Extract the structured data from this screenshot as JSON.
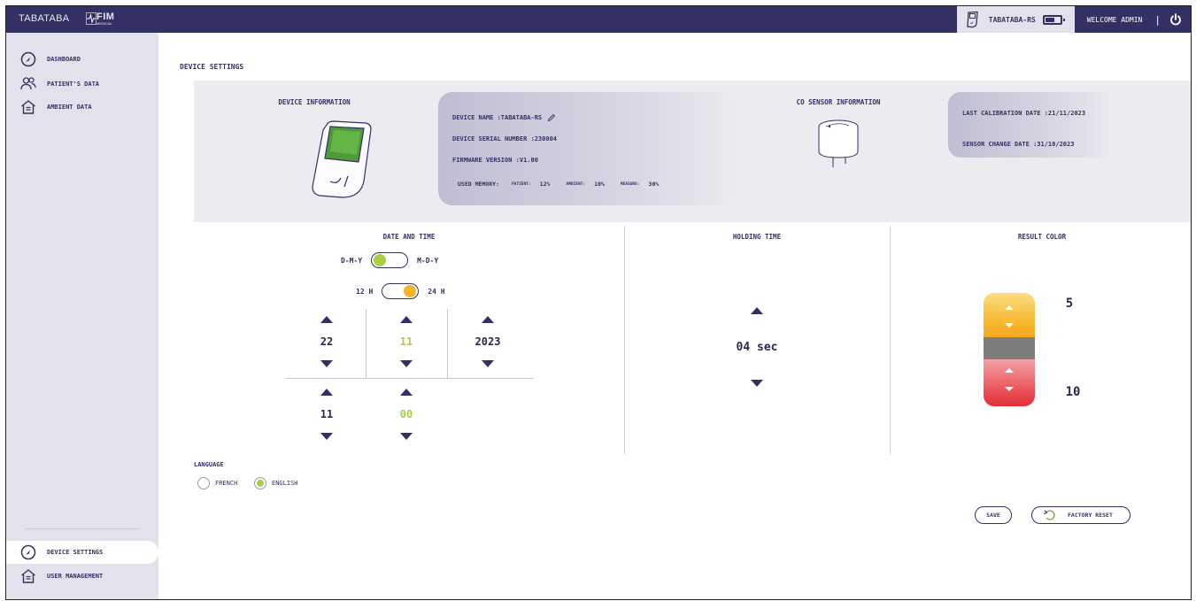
{
  "topbar": {
    "brand": "TABATABA",
    "logo_text": "FIM",
    "logo_sub": "MEDICAL",
    "device_name": "TABATABA-RS",
    "welcome": "WELCOME ADMIN",
    "separator": "|"
  },
  "sidebar": {
    "items": [
      {
        "label": "DASHBOARD",
        "icon": "dashboard-icon"
      },
      {
        "label": "PATIENT'S DATA",
        "icon": "users-icon"
      },
      {
        "label": "AMBIENT DATA",
        "icon": "house-icon"
      }
    ],
    "bottom_items": [
      {
        "label": "DEVICE SETTINGS",
        "icon": "dashboard-icon",
        "active": true
      },
      {
        "label": "USER MANAGEMENT",
        "icon": "house-icon",
        "active": false
      }
    ]
  },
  "page": {
    "title": "DEVICE SETTINGS"
  },
  "device_info": {
    "title": "DEVICE INFORMATION",
    "name_label": "DEVICE NAME :TABATABA-RS",
    "serial_label": "DEVICE SERIAL NUMBER :230004",
    "firmware_label": "FIRMWARE VERSION :V1.00",
    "memory_label": "USED MEMORY:",
    "memory": [
      {
        "key": "PATIENT:",
        "value": "12%"
      },
      {
        "key": "AMBIENT:",
        "value": "10%"
      },
      {
        "key": "MEASURE:",
        "value": "30%"
      }
    ]
  },
  "sensor_info": {
    "title": "CO SENSOR INFORMATION",
    "last_calibration": "LAST CALIBRATION DATE :21/11/2023",
    "sensor_change": "SENSOR CHANGE DATE :31/10/2023"
  },
  "date_time": {
    "title": "DATE AND TIME",
    "format_left": "D-M-Y",
    "format_right": "M-D-Y",
    "hour_left": "12 H",
    "hour_right": "24 H",
    "day": "22",
    "month": "11",
    "year": "2023",
    "hour": "11",
    "minute": "00"
  },
  "holding_time": {
    "title": "HOLDING TIME",
    "value": "04 sec"
  },
  "result_color": {
    "title": "RESULT COLOR",
    "upper": "5",
    "lower": "10",
    "colors": {
      "yellow": "#f8b52b",
      "gray": "#7d7d7d",
      "red": "#e02f36"
    }
  },
  "language": {
    "title": "LANGUAGE",
    "options": [
      {
        "label": "FRENCH",
        "selected": false
      },
      {
        "label": "ENGLISH",
        "selected": true
      }
    ]
  },
  "actions": {
    "save": "SAVE",
    "factory_reset": "FACTORY RESET"
  },
  "colors": {
    "navy": "#333163",
    "accent_green": "#a8cf45",
    "accent_orange": "#f6b42a",
    "sidebar_bg": "#e3e2ec"
  }
}
